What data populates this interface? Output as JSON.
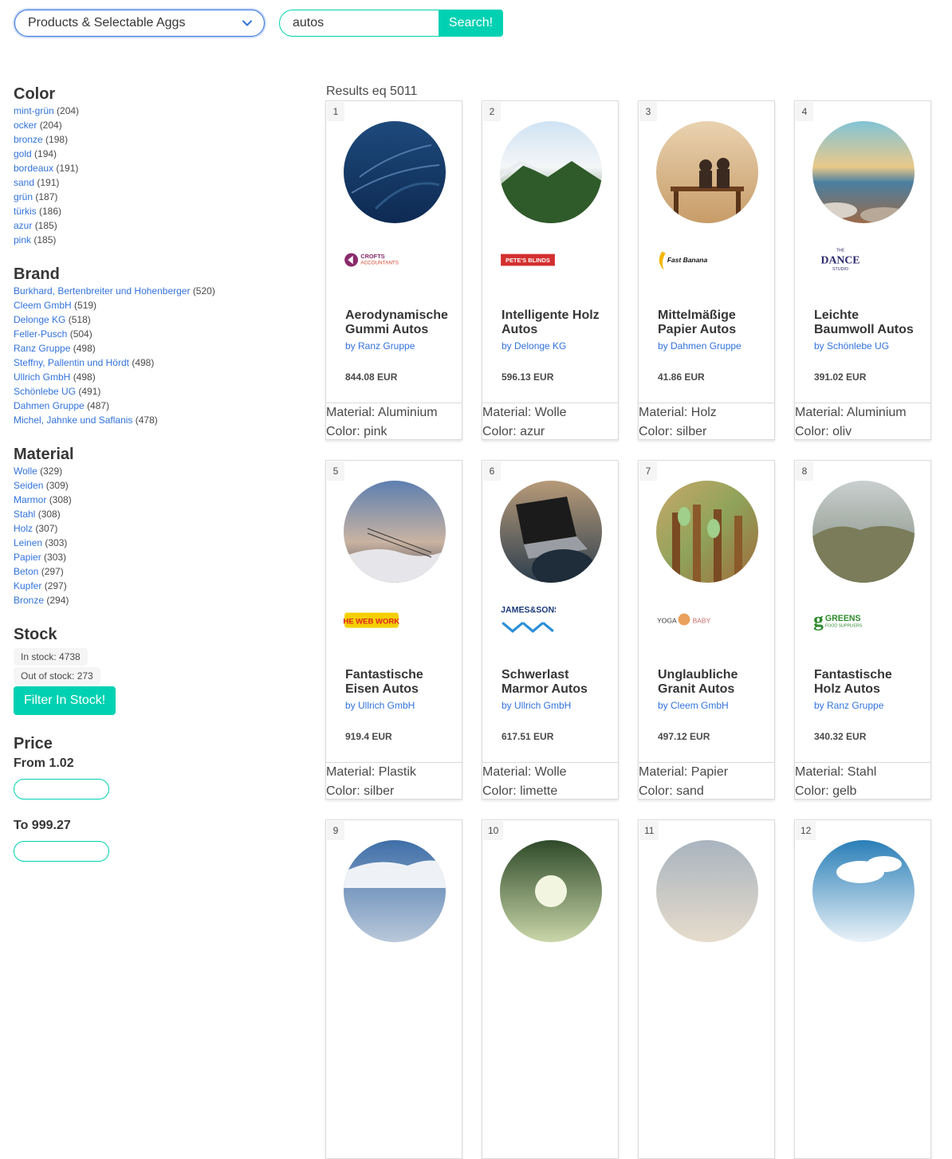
{
  "search": {
    "index_select": "Products & Selectable Aggs",
    "query": "autos",
    "button": "Search!"
  },
  "facets": {
    "color": {
      "title": "Color",
      "items": [
        {
          "label": "mint-grün",
          "count": "(204)"
        },
        {
          "label": "ocker",
          "count": "(204)"
        },
        {
          "label": "bronze",
          "count": "(198)"
        },
        {
          "label": "gold",
          "count": "(194)"
        },
        {
          "label": "bordeaux",
          "count": "(191)"
        },
        {
          "label": "sand",
          "count": "(191)"
        },
        {
          "label": "grün",
          "count": "(187)"
        },
        {
          "label": "türkis",
          "count": "(186)"
        },
        {
          "label": "azur",
          "count": "(185)"
        },
        {
          "label": "pink",
          "count": "(185)"
        }
      ]
    },
    "brand": {
      "title": "Brand",
      "items": [
        {
          "label": "Burkhard, Bertenbreiter und Hohenberger",
          "count": "(520)"
        },
        {
          "label": "Cleem GmbH",
          "count": "(519)"
        },
        {
          "label": "Delonge KG",
          "count": "(518)"
        },
        {
          "label": "Feller-Pusch",
          "count": "(504)"
        },
        {
          "label": "Ranz Gruppe",
          "count": "(498)"
        },
        {
          "label": "Steffny, Pallentin und Hördt",
          "count": "(498)"
        },
        {
          "label": "Ullrich GmbH",
          "count": "(498)"
        },
        {
          "label": "Schönlebe UG",
          "count": "(491)"
        },
        {
          "label": "Dahmen Gruppe",
          "count": "(487)"
        },
        {
          "label": "Michel, Jahnke und Saflanis",
          "count": "(478)"
        }
      ]
    },
    "material": {
      "title": "Material",
      "items": [
        {
          "label": "Wolle",
          "count": "(329)"
        },
        {
          "label": "Seiden",
          "count": "(309)"
        },
        {
          "label": "Marmor",
          "count": "(308)"
        },
        {
          "label": "Stahl",
          "count": "(308)"
        },
        {
          "label": "Holz",
          "count": "(307)"
        },
        {
          "label": "Leinen",
          "count": "(303)"
        },
        {
          "label": "Papier",
          "count": "(303)"
        },
        {
          "label": "Beton",
          "count": "(297)"
        },
        {
          "label": "Kupfer",
          "count": "(297)"
        },
        {
          "label": "Bronze",
          "count": "(294)"
        }
      ]
    },
    "stock": {
      "title": "Stock",
      "in_stock": "In stock: 4738",
      "out_of_stock": "Out of stock: 273",
      "filter_button": "Filter In Stock!"
    },
    "price": {
      "title": "Price",
      "from": "From 1.02",
      "to": "To 999.27"
    }
  },
  "results": {
    "heading": "Results eq 5011",
    "cards": [
      {
        "num": "1",
        "title": "Aerodynamische Gummi Autos",
        "brand": "by Ranz Gruppe",
        "price": "844.08 EUR",
        "material": "Material: Aluminium",
        "color": "Color: pink",
        "logo": "CROFTS ACCOUNTANTS"
      },
      {
        "num": "2",
        "title": "Intelligente Holz Autos",
        "brand": "by Delonge KG",
        "price": "596.13 EUR",
        "material": "Material: Wolle",
        "color": "Color: azur",
        "logo": "PETE'S BLINDS"
      },
      {
        "num": "3",
        "title": "Mittelmäßige Papier Autos",
        "brand": "by Dahmen Gruppe",
        "price": "41.86 EUR",
        "material": "Material: Holz",
        "color": "Color: silber",
        "logo": "Fast Banana"
      },
      {
        "num": "4",
        "title": "Leichte Baumwoll Autos",
        "brand": "by Schönlebe UG",
        "price": "391.02 EUR",
        "material": "Material: Aluminium",
        "color": "Color: oliv",
        "logo": "THE DANCE STUDIO"
      },
      {
        "num": "5",
        "title": "Fantastische Eisen Autos",
        "brand": "by Ullrich GmbH",
        "price": "919.4 EUR",
        "material": "Material: Plastik",
        "color": "Color: silber",
        "logo": "THE WEB WORKS"
      },
      {
        "num": "6",
        "title": "Schwerlast Marmor Autos",
        "brand": "by Ullrich GmbH",
        "price": "617.51 EUR",
        "material": "Material: Wolle",
        "color": "Color: limette",
        "logo": "JAMES&SONS"
      },
      {
        "num": "7",
        "title": "Unglaubliche Granit Autos",
        "brand": "by Cleem GmbH",
        "price": "497.12 EUR",
        "material": "Material: Papier",
        "color": "Color: sand",
        "logo": "YOGA BABY"
      },
      {
        "num": "8",
        "title": "Fantastische Holz Autos",
        "brand": "by Ranz Gruppe",
        "price": "340.32 EUR",
        "material": "Material: Stahl",
        "color": "Color: gelb",
        "logo": "GREENS FOOD SUPPLIERS"
      },
      {
        "num": "9"
      },
      {
        "num": "10"
      },
      {
        "num": "11"
      },
      {
        "num": "12"
      }
    ]
  },
  "colors": {
    "primary": "#00d1b2",
    "link": "#3273dc",
    "border": "#dbdbdb"
  }
}
